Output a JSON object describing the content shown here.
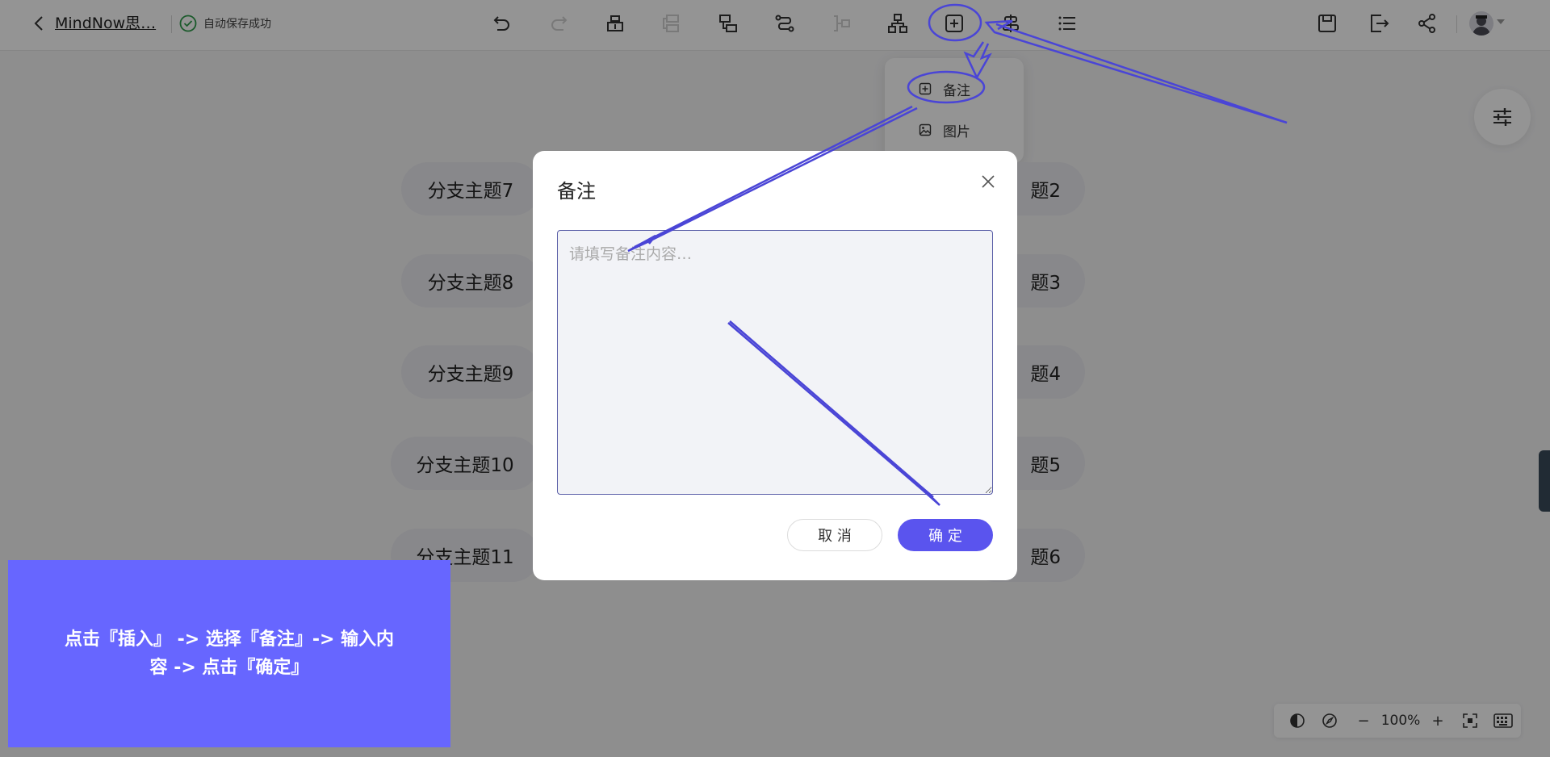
{
  "header": {
    "doc_title": "MindNow思…",
    "save_status": "自动保存成功"
  },
  "toolbar": {
    "tools": [
      "undo-icon",
      "redo-icon",
      "insert-topic-icon",
      "insert-subtopic-icon",
      "insert-parent-icon",
      "relation-line-icon",
      "summary-icon",
      "structure-icon",
      "insert-icon",
      "outline-icon",
      "list-icon"
    ],
    "right_tools": [
      "save-icon",
      "export-icon",
      "share-icon"
    ]
  },
  "insert_menu": {
    "items": [
      {
        "label": "备注",
        "icon": "note-icon"
      },
      {
        "label": "图片",
        "icon": "image-icon"
      }
    ]
  },
  "canvas": {
    "left_nodes": [
      "分支主题7",
      "分支主题8",
      "分支主题9",
      "分支主题10",
      "分支主题11"
    ],
    "right_nodes": [
      "题2",
      "题3",
      "题4",
      "题5",
      "题6"
    ]
  },
  "note_dialog": {
    "title": "备注",
    "placeholder": "请填写备注内容…",
    "value": "",
    "cancel_label": "取 消",
    "ok_label": "确 定"
  },
  "zoom_bar": {
    "zoom_out": "−",
    "zoom_level": "100%",
    "zoom_in": "+"
  },
  "instruction": {
    "text": "点击『插入』 -> 选择『备注』-> 输入内容 -> 点击『确定』"
  },
  "colors": {
    "accent": "#5a54ee",
    "callout": "#6766ff",
    "annotation": "#4a45d6"
  }
}
